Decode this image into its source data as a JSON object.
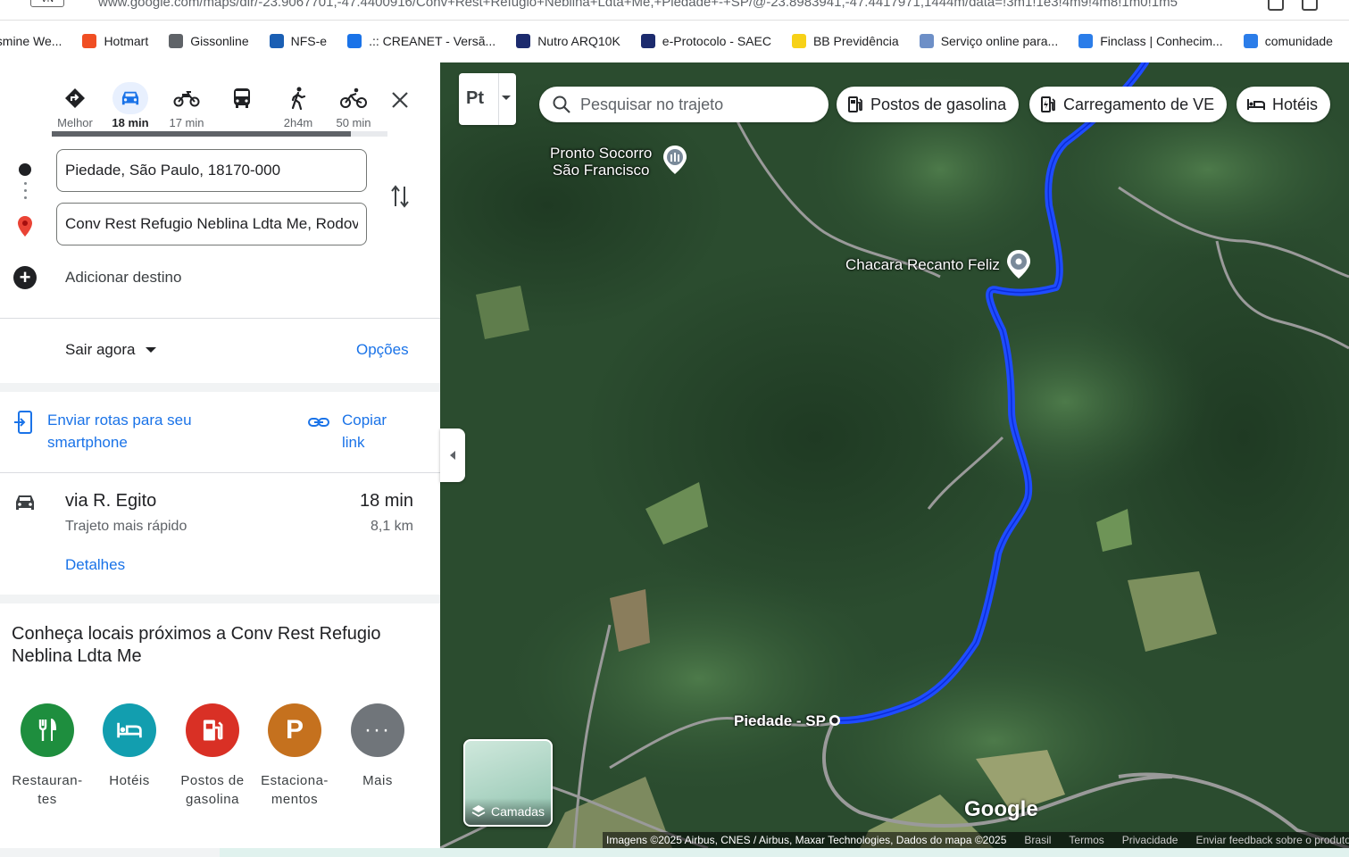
{
  "browser": {
    "badge": "VN",
    "url": "www.google.com/maps/dir/-23.9067701,-47.4400916/Conv+Rest+Refugio+Neblina+Ldta+Me,+Piedade+-+SP/@-23.8983941,-47.4417971,1444m/data=!3m1!1e3!4m9!4m8!1m0!1m5",
    "bookmarks": [
      {
        "label": "asmine We...",
        "color": "#c93a8f"
      },
      {
        "label": "Hotmart",
        "color": "#f04e23"
      },
      {
        "label": "Gissonline",
        "color": "#5f6368"
      },
      {
        "label": "NFS-e",
        "color": "#1a5fb4"
      },
      {
        "label": ".:: CREANET - Versã...",
        "color": "#1a73e8"
      },
      {
        "label": "Nutro ARQ10K",
        "color": "#1c2b6e"
      },
      {
        "label": "e-Protocolo - SAEC",
        "color": "#1c2b6e"
      },
      {
        "label": "BB Previdência",
        "color": "#f7d117"
      },
      {
        "label": "Serviço online para...",
        "color": "#6d8fc7"
      },
      {
        "label": "Finclass | Conhecim...",
        "color": "#2b7de9"
      },
      {
        "label": "comunidade",
        "color": "#2b7de9"
      }
    ]
  },
  "directions": {
    "modes": [
      {
        "name": "best",
        "label": "Melhor",
        "icon": "diamond-turn-icon",
        "selected": false
      },
      {
        "name": "car",
        "label": "18 min",
        "icon": "car-icon",
        "selected": true
      },
      {
        "name": "motorcycle",
        "label": "17 min",
        "icon": "motorcycle-icon",
        "selected": false
      },
      {
        "name": "transit",
        "label": "",
        "icon": "bus-icon",
        "selected": false
      },
      {
        "name": "walk",
        "label": "2h4m",
        "icon": "walk-icon",
        "selected": false
      },
      {
        "name": "bike",
        "label": "50 min",
        "icon": "bike-icon",
        "selected": false
      }
    ],
    "loading_progress": 0.89,
    "origin": "Piedade, São Paulo, 18170-000",
    "destination": "Conv Rest Refugio Neblina Ldta Me, Rodovia",
    "add_destination": "Adicionar destino",
    "depart_label": "Sair agora",
    "options_label": "Opções",
    "send_label": "Enviar rotas para seu smartphone",
    "copy_label": "Copiar link",
    "route": {
      "via": "via R. Egito",
      "subtitle": "Trajeto mais rápido",
      "time": "18 min",
      "distance": "8,1 km",
      "details_label": "Detalhes"
    },
    "nearby_title": "Conheça locais próximos a Conv Rest Refugio Neblina Ldta Me",
    "categories": [
      {
        "label": "Restauran-\ntes",
        "color": "#1e8e3e",
        "icon": "restaurant-icon"
      },
      {
        "label": "Hotéis",
        "color": "#129eaf",
        "icon": "hotel-icon"
      },
      {
        "label": "Postos de\ngasolina",
        "color": "#d93025",
        "icon": "gas-station-icon"
      },
      {
        "label": "Estaciona-\nmentos",
        "color": "#c5711e",
        "icon": "parking-icon"
      },
      {
        "label": "Mais",
        "color": "#70757a",
        "icon": "more-icon"
      }
    ]
  },
  "map": {
    "route_color": "#1f4cff",
    "pt_label": "Pt",
    "search_placeholder": "Pesquisar no trajeto",
    "chips": [
      {
        "label": "Postos de gasolina",
        "icon": "gas-station-icon"
      },
      {
        "label": "Carregamento de VE",
        "icon": "ev-charging-icon"
      },
      {
        "label": "Hotéis",
        "icon": "hotel-icon"
      }
    ],
    "places": {
      "hospital_line1": "Pronto Socorro",
      "hospital_line2": "São Francisco",
      "farm": "Chacara Recanto Feliz",
      "origin_city": "Piedade - SP"
    },
    "layers_label": "Camadas",
    "google_logo": "Google",
    "attribution": {
      "imagery": "Imagens ©2025 Airbus, CNES / Airbus, Maxar Technologies, Dados do mapa ©2025",
      "country": "Brasil",
      "terms": "Termos",
      "privacy": "Privacidade",
      "feedback": "Enviar feedback sobre o produto"
    }
  }
}
